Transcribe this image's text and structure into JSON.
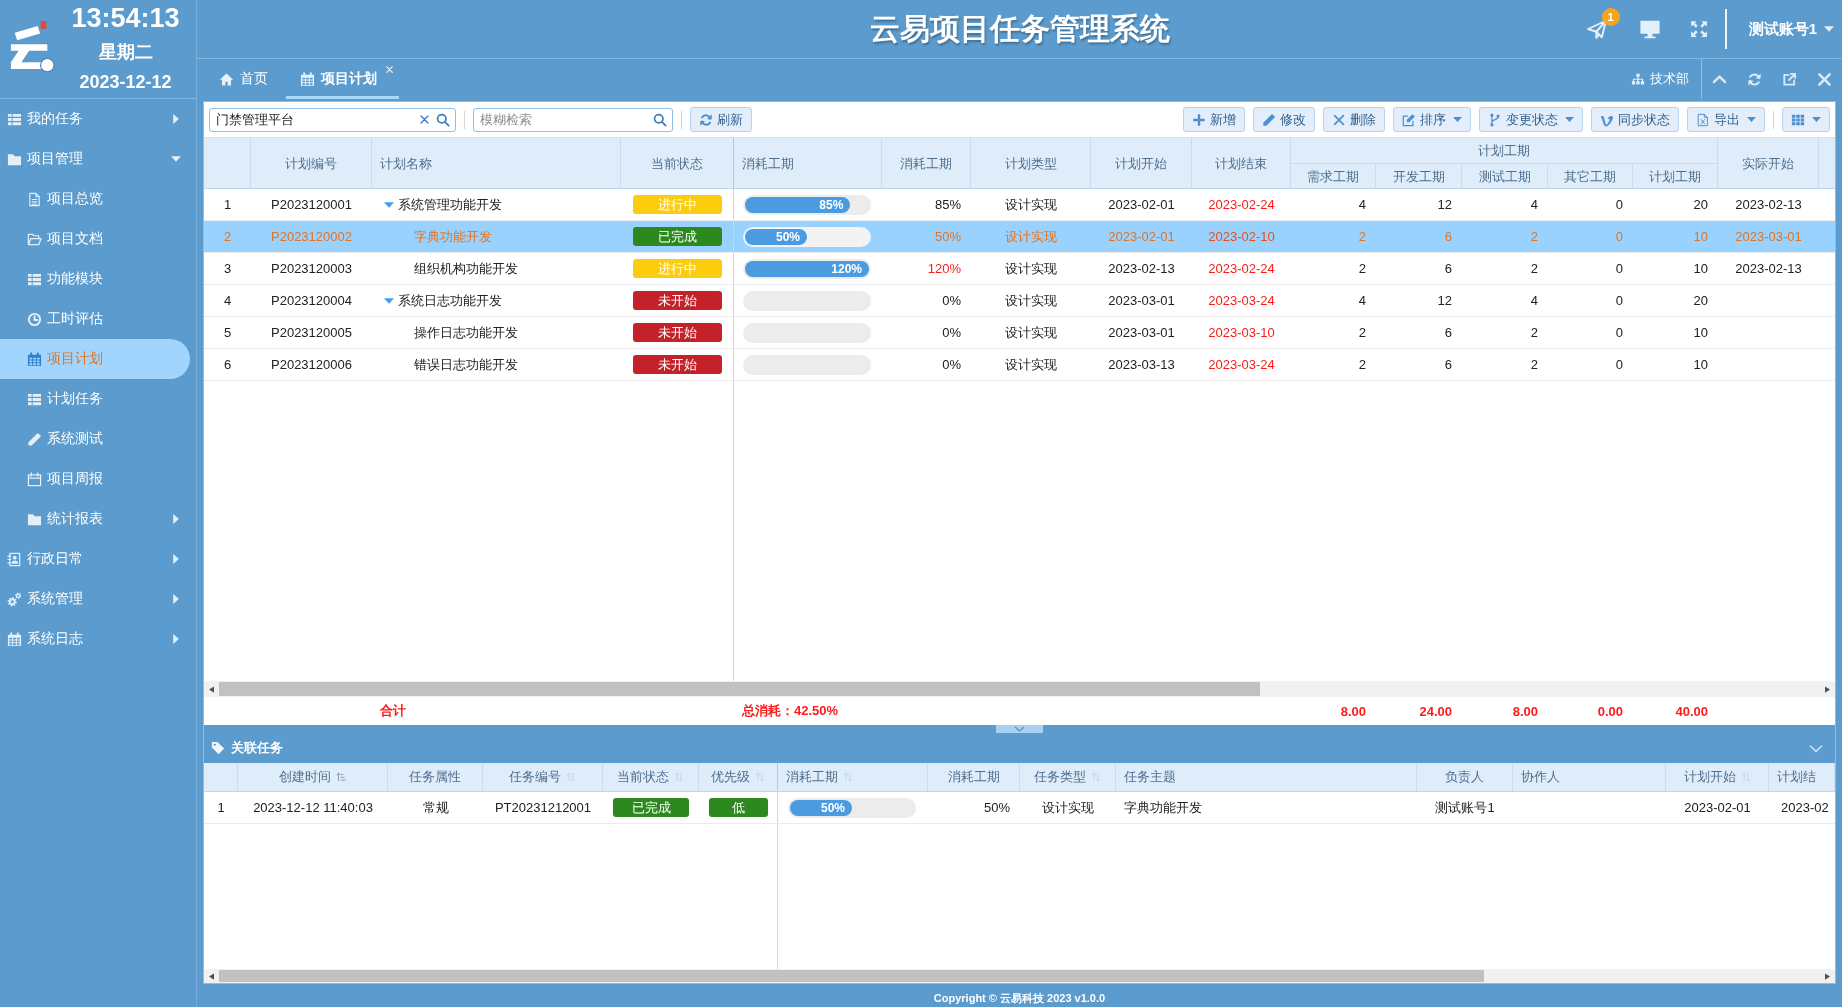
{
  "header": {
    "clock": "13:54:13",
    "weekday": "星期二",
    "date": "2023-12-12",
    "title": "云易项目任务管理系统",
    "notifications": "1",
    "user": "测试账号1"
  },
  "sidebar": {
    "items": [
      {
        "label": "我的任务",
        "selected": false,
        "expanded": false
      },
      {
        "label": "项目管理",
        "selected": false,
        "expanded": true,
        "children": [
          {
            "label": "项目总览",
            "selected": false
          },
          {
            "label": "项目文档",
            "selected": false
          },
          {
            "label": "功能模块",
            "selected": false
          },
          {
            "label": "工时评估",
            "selected": false
          },
          {
            "label": "项目计划",
            "selected": true
          },
          {
            "label": "计划任务",
            "selected": false
          },
          {
            "label": "系统测试",
            "selected": false
          },
          {
            "label": "项目周报",
            "selected": false
          },
          {
            "label": "统计报表",
            "selected": false,
            "expanded": false
          }
        ]
      },
      {
        "label": "行政日常",
        "selected": false,
        "expanded": false
      },
      {
        "label": "系统管理",
        "selected": false,
        "expanded": false
      },
      {
        "label": "系统日志",
        "selected": false,
        "expanded": false
      }
    ]
  },
  "tabs": [
    {
      "label": "首页",
      "selected": false,
      "closable": false
    },
    {
      "label": "项目计划",
      "selected": true,
      "closable": true
    }
  ],
  "tab_bar": {
    "department": "技术部"
  },
  "toolbar": {
    "project_filter": {
      "value": "门禁管理平台"
    },
    "search": {
      "placeholder": "模糊检索"
    },
    "refresh": "刷新",
    "actions": [
      {
        "label": "新增",
        "dropdown": false
      },
      {
        "label": "修改",
        "dropdown": false
      },
      {
        "label": "删除",
        "dropdown": false
      },
      {
        "label": "排序",
        "dropdown": true
      },
      {
        "label": "变更状态",
        "dropdown": true
      },
      {
        "label": "同步状态",
        "dropdown": false
      },
      {
        "label": "导出",
        "dropdown": true
      }
    ],
    "view_button": {
      "dropdown": true
    }
  },
  "plan_table": {
    "columns": [
      {
        "label": "计划编号"
      },
      {
        "label": "计划名称"
      },
      {
        "label": "当前状态"
      },
      {
        "label": "消耗工期"
      },
      {
        "label": "消耗工期"
      },
      {
        "label": "计划类型"
      },
      {
        "label": "计划开始"
      },
      {
        "label": "计划结束"
      },
      {
        "label": "计划工期",
        "children": [
          {
            "label": "需求工期"
          },
          {
            "label": "开发工期"
          },
          {
            "label": "测试工期"
          },
          {
            "label": "其它工期"
          },
          {
            "label": "计划工期"
          }
        ]
      },
      {
        "label": "实际开始"
      }
    ],
    "rows": [
      {
        "no": "1",
        "code": "P2023120001",
        "name": "系统管理功能开发",
        "status": {
          "label": "进行中",
          "color": "#fbcd0e"
        },
        "level": 0.85,
        "progress_label": "85%",
        "consumed": "85%",
        "overrun": false,
        "type": "设计实现",
        "start": "2023-02-01",
        "end": "2023-02-24",
        "overdue": true,
        "durations": [
          "4",
          "12",
          "4",
          "0",
          "20"
        ],
        "actual_start": "2023-02-13",
        "selected": false,
        "expanded": true,
        "children": [
          {
            "no": "2",
            "code": "P2023120002",
            "name": "字典功能开发",
            "status": {
              "label": "已完成",
              "color": "#2b891d"
            },
            "level": 0.5,
            "progress_label": "50%",
            "consumed": "50%",
            "overrun": false,
            "type": "设计实现",
            "start": "2023-02-01",
            "end": "2023-02-10",
            "overdue": true,
            "durations": [
              "2",
              "6",
              "2",
              "0",
              "10"
            ],
            "actual_start": "2023-03-01",
            "selected": true
          },
          {
            "no": "3",
            "code": "P2023120003",
            "name": "组织机构功能开发",
            "status": {
              "label": "进行中",
              "color": "#fbcd0e"
            },
            "level": 1,
            "progress_label": "120%",
            "consumed": "120%",
            "overrun": true,
            "type": "设计实现",
            "start": "2023-02-13",
            "end": "2023-02-24",
            "overdue": true,
            "durations": [
              "2",
              "6",
              "2",
              "0",
              "10"
            ],
            "actual_start": "2023-02-13",
            "selected": false
          }
        ]
      },
      {
        "no": "4",
        "code": "P2023120004",
        "name": "系统日志功能开发",
        "status": {
          "label": "未开始",
          "color": "#c4212a"
        },
        "consumed": "0%",
        "overrun": false,
        "type": "设计实现",
        "start": "2023-03-01",
        "end": "2023-03-24",
        "overdue": true,
        "durations": [
          "4",
          "12",
          "4",
          "0",
          "20"
        ],
        "selected": false,
        "expanded": true,
        "children": [
          {
            "no": "5",
            "code": "P2023120005",
            "name": "操作日志功能开发",
            "status": {
              "label": "未开始",
              "color": "#c4212a"
            },
            "consumed": "0%",
            "overrun": false,
            "type": "设计实现",
            "start": "2023-03-01",
            "end": "2023-03-10",
            "overdue": true,
            "durations": [
              "2",
              "6",
              "2",
              "0",
              "10"
            ],
            "selected": false
          },
          {
            "no": "6",
            "code": "P2023120006",
            "name": "错误日志功能开发",
            "status": {
              "label": "未开始",
              "color": "#c4212a"
            },
            "consumed": "0%",
            "overrun": false,
            "type": "设计实现",
            "start": "2023-03-13",
            "end": "2023-03-24",
            "overdue": true,
            "durations": [
              "2",
              "6",
              "2",
              "0",
              "10"
            ],
            "selected": false
          }
        ]
      }
    ],
    "totals": {
      "label": "合计",
      "consumption": "总消耗：42.50%",
      "durations": [
        "8.00",
        "24.00",
        "8.00",
        "0.00",
        "40.00"
      ]
    }
  },
  "related_tasks": {
    "title": "关联任务",
    "columns": [
      {
        "label": "创建时间",
        "sortable": true,
        "sorted": true
      },
      {
        "label": "任务属性",
        "sortable": false,
        "sorted": false
      },
      {
        "label": "任务编号",
        "sortable": true,
        "sorted": false
      },
      {
        "label": "当前状态",
        "sortable": true,
        "sorted": false
      },
      {
        "label": "优先级",
        "sortable": true,
        "sorted": false
      },
      {
        "label": "消耗工期",
        "sortable": true,
        "sorted": false
      },
      {
        "label": "消耗工期",
        "sortable": false,
        "sorted": false
      },
      {
        "label": "任务类型",
        "sortable": true,
        "sorted": false
      },
      {
        "label": "任务主题",
        "sortable": false,
        "sorted": false
      },
      {
        "label": "负责人",
        "sortable": false,
        "sorted": false
      },
      {
        "label": "协作人",
        "sortable": false,
        "sorted": false
      },
      {
        "label": "计划开始",
        "sortable": true,
        "sorted": false
      },
      {
        "label": "计划结",
        "sortable": false,
        "sorted": false
      }
    ],
    "rows": [
      {
        "no": "1",
        "created": "2023-12-12 11:40:03",
        "attribute": "常规",
        "code": "PT20231212001",
        "status": {
          "label": "已完成",
          "color": "#2b891d"
        },
        "priority": {
          "label": "低",
          "color": "#2b891d"
        },
        "level": 0.5,
        "progress_label": "50%",
        "consumed": "50%",
        "type": "设计实现",
        "subject": "字典功能开发",
        "owner": "测试账号1",
        "start": "2023-02-01",
        "end": "2023-02",
        "selected": false
      }
    ]
  },
  "footer": "Copyright © 云易科技 2023 v1.0.0"
}
